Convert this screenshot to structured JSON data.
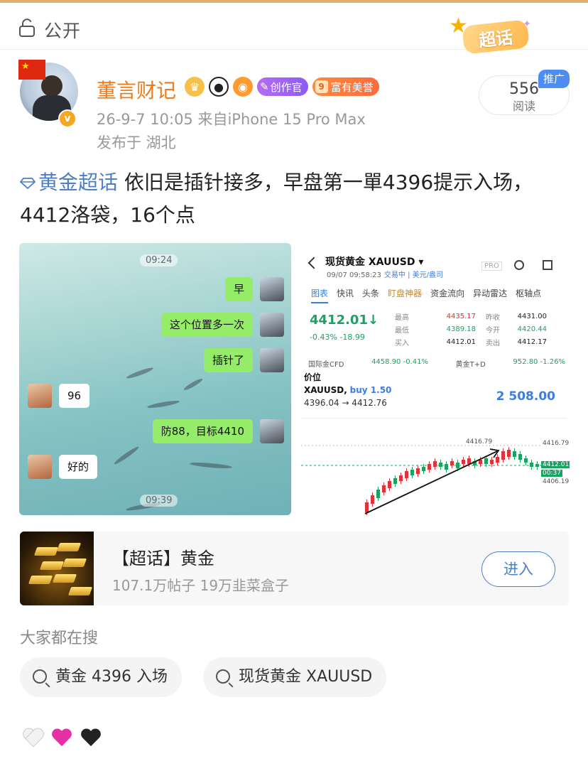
{
  "topbar": {
    "visibility_label": "公开",
    "super_badge_label": "超话"
  },
  "author": {
    "name": "董言财记",
    "badge_creator": "创作官",
    "badge_rich_level": "9",
    "badge_rich": "富有美誉",
    "time_source": "26-9-7 10:05  来自iPhone 15 Pro Max",
    "location": "发布于 湖北"
  },
  "stats": {
    "reads_count": "556",
    "reads_label": "阅读",
    "promo_label": "推广"
  },
  "post": {
    "topic": "黄金超话",
    "text": " 依旧是插针接多，早盘第一單4396提示入场，4412洛袋，16个点"
  },
  "chat_image": {
    "time_top": "09:24",
    "time_bottom": "09:39",
    "messages": [
      {
        "side": "right",
        "text": "早"
      },
      {
        "side": "right",
        "text": "这个位置多一次"
      },
      {
        "side": "right",
        "text": "插针了"
      },
      {
        "side": "left",
        "text": "96"
      },
      {
        "side": "right",
        "text": "防88，目标4410"
      },
      {
        "side": "left",
        "text": "好的"
      }
    ]
  },
  "trade_image": {
    "title": "现货黄金 XAUUSD ▾",
    "subtitle": "09/07 09:58:23",
    "subtitle_tag": "交易中 | 美元/盎司",
    "pro_label": "PRO",
    "tabs": [
      "图表",
      "快讯",
      "头条",
      "盯盘神器",
      "资金流向",
      "异动雷达",
      "枢轴点"
    ],
    "price": "4412.01↓",
    "change": "-0.43%  -18.99",
    "stats": [
      {
        "k": "最高",
        "v": "4435.17",
        "k2": "昨收",
        "v2": "4431.00"
      },
      {
        "k": "最低",
        "v": "4389.18",
        "k2": "今开",
        "v2": "4420.44"
      },
      {
        "k": "买入",
        "v": "4412.01",
        "k2": "卖出",
        "v2": "4412.17"
      }
    ],
    "cfd_left": "国际金CFD",
    "cfd_left_val": "4458.90  -0.41%",
    "cfd_right": "黄金T+D",
    "cfd_right_val": "952.80  -1.26%",
    "position_label": "价位",
    "position_symbol": "XAUUSD,",
    "position_side": "buy 1.50",
    "position_range": "4396.04 → 4412.76",
    "position_profit": "2 508.00",
    "chart_labels": {
      "peak": "4416.79",
      "right_top": "4416.79",
      "current": "4412.01",
      "countdown": "00:37",
      "right_low": "4406.19"
    }
  },
  "community_card": {
    "title": "【超话】黄金",
    "subtitle": "107.1万帖子 19万韭菜盒子",
    "enter_label": "进入"
  },
  "search": {
    "heading": "大家都在搜",
    "chips": [
      "黄金 4396 入场",
      "现货黄金 XAUUSD"
    ]
  }
}
